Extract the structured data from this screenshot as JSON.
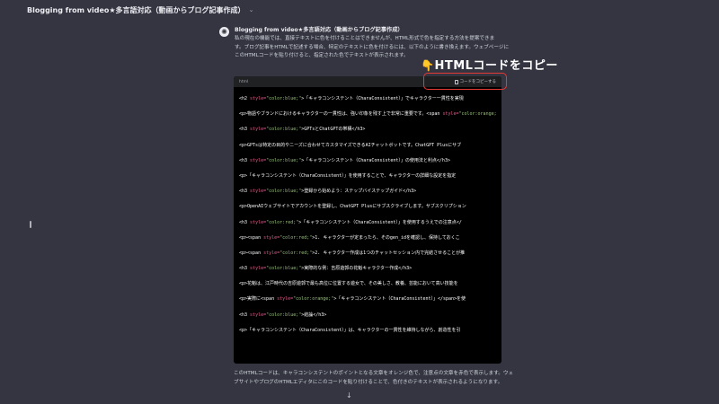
{
  "header": {
    "title": "Blogging from video★多言語対応（動画からブログ記事作成）",
    "chevron_icon": "chevron-down-icon"
  },
  "message": {
    "avatar_icon": "chatgpt-logo-icon",
    "title": "Blogging from video★多言語対応（動画からブログ記事作成）",
    "intro_lines": [
      "私の現在の機能では、直接テキストに色を付けることはできませんが、HTML形式で色を指定する方法を提案できま",
      "す。ブログ記事をHTMLで記述する場合、特定のテキストに色を付けるには、以下のように書き換えます。ウェブページに",
      "このHTMLコードを貼り付けると、指定された色でテキストが表示されます。"
    ],
    "after_lines": [
      "このHTMLコードは、キャラコンシステントのポイントとなる文章をオレンジ色で、注意点の文章を赤色で表示します。ウェ",
      "ブサイトやブログのHTMLエディタにこのコードを貼り付けることで、色付きのテキストが表示されるようになります。"
    ]
  },
  "annotation": {
    "hand_icon": "pointing-hand-icon",
    "text": "HTMLコードをコピー",
    "box_color": "#e53935"
  },
  "code_block": {
    "language": "html",
    "copy_label": "コードをコピーする",
    "lines": [
      [
        {
          "t": "<h2 ",
          "c": "tag"
        },
        {
          "t": "style=",
          "c": "attr"
        },
        {
          "t": "\"color:blue;\"",
          "c": "str"
        },
        {
          "t": ">「キャラコンシステント（CharaConsistent）」でキャラクター一貫性を実現",
          "c": "tag"
        }
      ],
      [
        {
          "t": "<p>物語やブランドにおけるキャラクターの一貫性は、強い印象を残す上で非常に重要です。<span ",
          "c": "tag"
        },
        {
          "t": "style=",
          "c": "attr"
        },
        {
          "t": "\"color:orange;\"",
          "c": "str"
        }
      ],
      [
        {
          "t": "<h3 ",
          "c": "tag"
        },
        {
          "t": "style=",
          "c": "attr"
        },
        {
          "t": "\"color:blue;\"",
          "c": "str"
        },
        {
          "t": ">GPTsとChatGPTの帯構</h3>",
          "c": "tag"
        }
      ],
      [
        {
          "t": "<p>GPTsは特定の目的やニーズに合わせてカスタマイズできるAIチャットボットです。ChatGPT Plusにサブ",
          "c": "tag"
        }
      ],
      [
        {
          "t": "<h3 ",
          "c": "tag"
        },
        {
          "t": "style=",
          "c": "attr"
        },
        {
          "t": "\"color:blue;\"",
          "c": "str"
        },
        {
          "t": ">「キャラコンシステント（CharaConsistent）」の使用法と利点</h3>",
          "c": "tag"
        }
      ],
      [
        {
          "t": "<p>「キャラコンシステント（CharaConsistent）」を使用することで、キャラクターの詳細な設定を指定",
          "c": "tag"
        }
      ],
      [
        {
          "t": "<h3 ",
          "c": "tag"
        },
        {
          "t": "style=",
          "c": "attr"
        },
        {
          "t": "\"color:blue;\"",
          "c": "str"
        },
        {
          "t": ">登録から始めよう：ステップバイステップガイド</h3>",
          "c": "tag"
        }
      ],
      [
        {
          "t": "<p>OpenAIウェブサイトでアカウントを登録し、ChatGPT Plusにサブスクライブします。サブスクリプション",
          "c": "tag"
        }
      ],
      [
        {
          "t": "<h3 ",
          "c": "tag"
        },
        {
          "t": "style=",
          "c": "attr"
        },
        {
          "t": "\"color:red;\"",
          "c": "str"
        },
        {
          "t": ">「キャラコンシステント（CharaConsistent）」を使用するうえでの注意点</",
          "c": "tag"
        }
      ],
      [
        {
          "t": "<p><span ",
          "c": "tag"
        },
        {
          "t": "style=",
          "c": "attr"
        },
        {
          "t": "\"color:red;\"",
          "c": "str"
        },
        {
          "t": ">1. キャラクターが定まったら、そのgen_idを確認し、保持しておくこ",
          "c": "tag"
        }
      ],
      [
        {
          "t": "<p><span ",
          "c": "tag"
        },
        {
          "t": "style=",
          "c": "attr"
        },
        {
          "t": "\"color:red;\"",
          "c": "str"
        },
        {
          "t": ">2. キャラクター作成は1つのチャットセッション内で完結させることが推",
          "c": "tag"
        }
      ],
      [
        {
          "t": "<h3 ",
          "c": "tag"
        },
        {
          "t": "style=",
          "c": "attr"
        },
        {
          "t": "\"color:blue;\"",
          "c": "str"
        },
        {
          "t": ">実際的な例：吉原遊郭の花魁キャラクター作成</h3>",
          "c": "tag"
        }
      ],
      [
        {
          "t": "<p>花魁は、江戸時代の吉原遊郭で最も高位に位置する遊女で、その美しさ、教養、芸能において高い技能を",
          "c": "tag"
        }
      ],
      [
        {
          "t": "<p>実際に<span ",
          "c": "tag"
        },
        {
          "t": "style=",
          "c": "attr"
        },
        {
          "t": "\"color:orange;\"",
          "c": "str"
        },
        {
          "t": ">「キャラコンシステント（CharaConsistent）」</span>を使",
          "c": "tag"
        }
      ],
      [
        {
          "t": "<h3 ",
          "c": "tag"
        },
        {
          "t": "style=",
          "c": "attr"
        },
        {
          "t": "\"color:blue;\"",
          "c": "str"
        },
        {
          "t": ">結論</h3>",
          "c": "tag"
        }
      ],
      [
        {
          "t": "<p>「キャラコンシステント（CharaConsistent）」は、キャラクターの一貫性を維持しながら、創造性を引",
          "c": "tag"
        }
      ]
    ]
  },
  "scroll_icon": "arrow-down-icon",
  "colors": {
    "background": "#343541",
    "code_background": "#000000",
    "attr": "#e05a8a",
    "string": "#98c379"
  }
}
